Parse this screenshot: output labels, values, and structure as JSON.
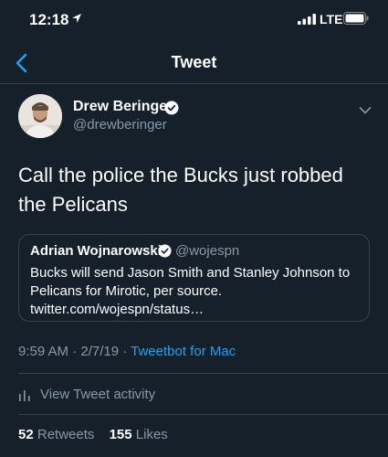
{
  "status_bar": {
    "time": "12:18",
    "network": "LTE"
  },
  "nav": {
    "title": "Tweet"
  },
  "tweet": {
    "author_name": "Drew Beringer",
    "author_handle": "@drewberinger",
    "text": "Call the police the Bucks just robbed the Pelicans",
    "timestamp": "9:59 AM · 2/7/19 · ",
    "source": "Tweetbot for Mac",
    "activity_label": "View Tweet activity",
    "retweets_count": "52",
    "retweets_label": "Retweets",
    "likes_count": "155",
    "likes_label": "Likes"
  },
  "quoted_tweet": {
    "author_name": "Adrian Wojnarowski",
    "author_handle": "@wojespn",
    "text": "Bucks will send Jason Smith and Stanley Johnson to Pelicans for Mirotic, per source. twitter.com/wojespn/status…"
  },
  "colors": {
    "background": "#15202b",
    "accent": "#1da1f2",
    "secondary_text": "#8899a6",
    "divider": "#38444d"
  }
}
